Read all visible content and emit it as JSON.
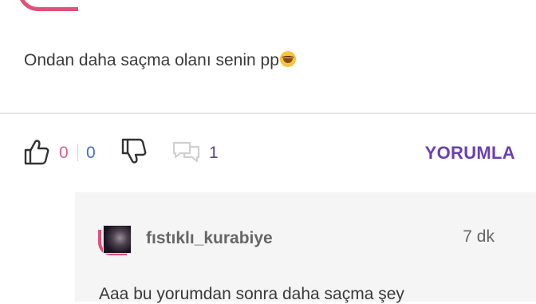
{
  "comment": {
    "text": "Ondan daha saçma olanı senin pp"
  },
  "actions": {
    "like_count": "0",
    "dislike_count": "0",
    "reply_count": "1",
    "comment_button_label": "YORUMLA"
  },
  "reply": {
    "username": "fıstıklı_kurabiye",
    "time": "7 dk",
    "text": "Aaa bu yorumdan sonra daha saçma şey"
  },
  "icons": {
    "like": "thumbs-up-icon",
    "dislike": "thumbs-down-icon",
    "replies": "speech-bubbles-icon",
    "emoji": "face-with-tears-of-joy-emoji"
  },
  "colors": {
    "like_accent": "#e35d88",
    "dislike_accent": "#3c6fd6",
    "primary_purple": "#6a3fb5",
    "avatar_ring": "#e0507a"
  }
}
